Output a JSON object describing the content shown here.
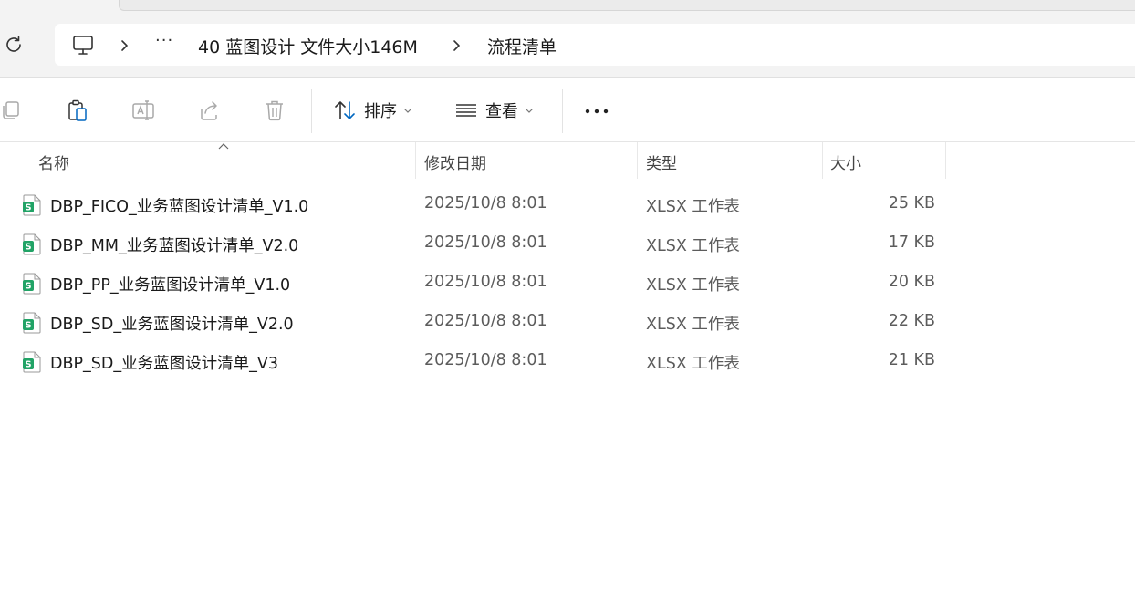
{
  "address_bar": {
    "overflow_glyph": "···",
    "crumbs": [
      "40 蓝图设计 文件大小146M",
      "流程清单"
    ],
    "icons": [
      "refresh-icon",
      "computer-icon",
      "chevron-right-icon"
    ]
  },
  "toolbar": {
    "sort_label": "排序",
    "view_label": "查看",
    "more_glyph": "•••",
    "icons": [
      "copy-icon",
      "paste-icon",
      "rename-icon",
      "share-icon",
      "delete-icon",
      "sort-icon",
      "view-icon",
      "more-icon"
    ]
  },
  "columns": {
    "name": "名称",
    "date": "修改日期",
    "type": "类型",
    "size": "大小"
  },
  "files": [
    {
      "name": "DBP_FICO_业务蓝图设计清单_V1.0",
      "date": "2025/10/8 8:01",
      "type": "XLSX 工作表",
      "size": "25 KB"
    },
    {
      "name": "DBP_MM_业务蓝图设计清单_V2.0",
      "date": "2025/10/8 8:01",
      "type": "XLSX 工作表",
      "size": "17 KB"
    },
    {
      "name": "DBP_PP_业务蓝图设计清单_V1.0",
      "date": "2025/10/8 8:01",
      "type": "XLSX 工作表",
      "size": "20 KB"
    },
    {
      "name": "DBP_SD_业务蓝图设计清单_V2.0",
      "date": "2025/10/8 8:01",
      "type": "XLSX 工作表",
      "size": "22 KB"
    },
    {
      "name": "DBP_SD_业务蓝图设计清单_V3",
      "date": "2025/10/8 8:01",
      "type": "XLSX 工作表",
      "size": "21 KB"
    }
  ],
  "colors": {
    "accent": "#0067c0",
    "excel_green": "#21a366",
    "disabled_icon": "#a9a9a9"
  }
}
